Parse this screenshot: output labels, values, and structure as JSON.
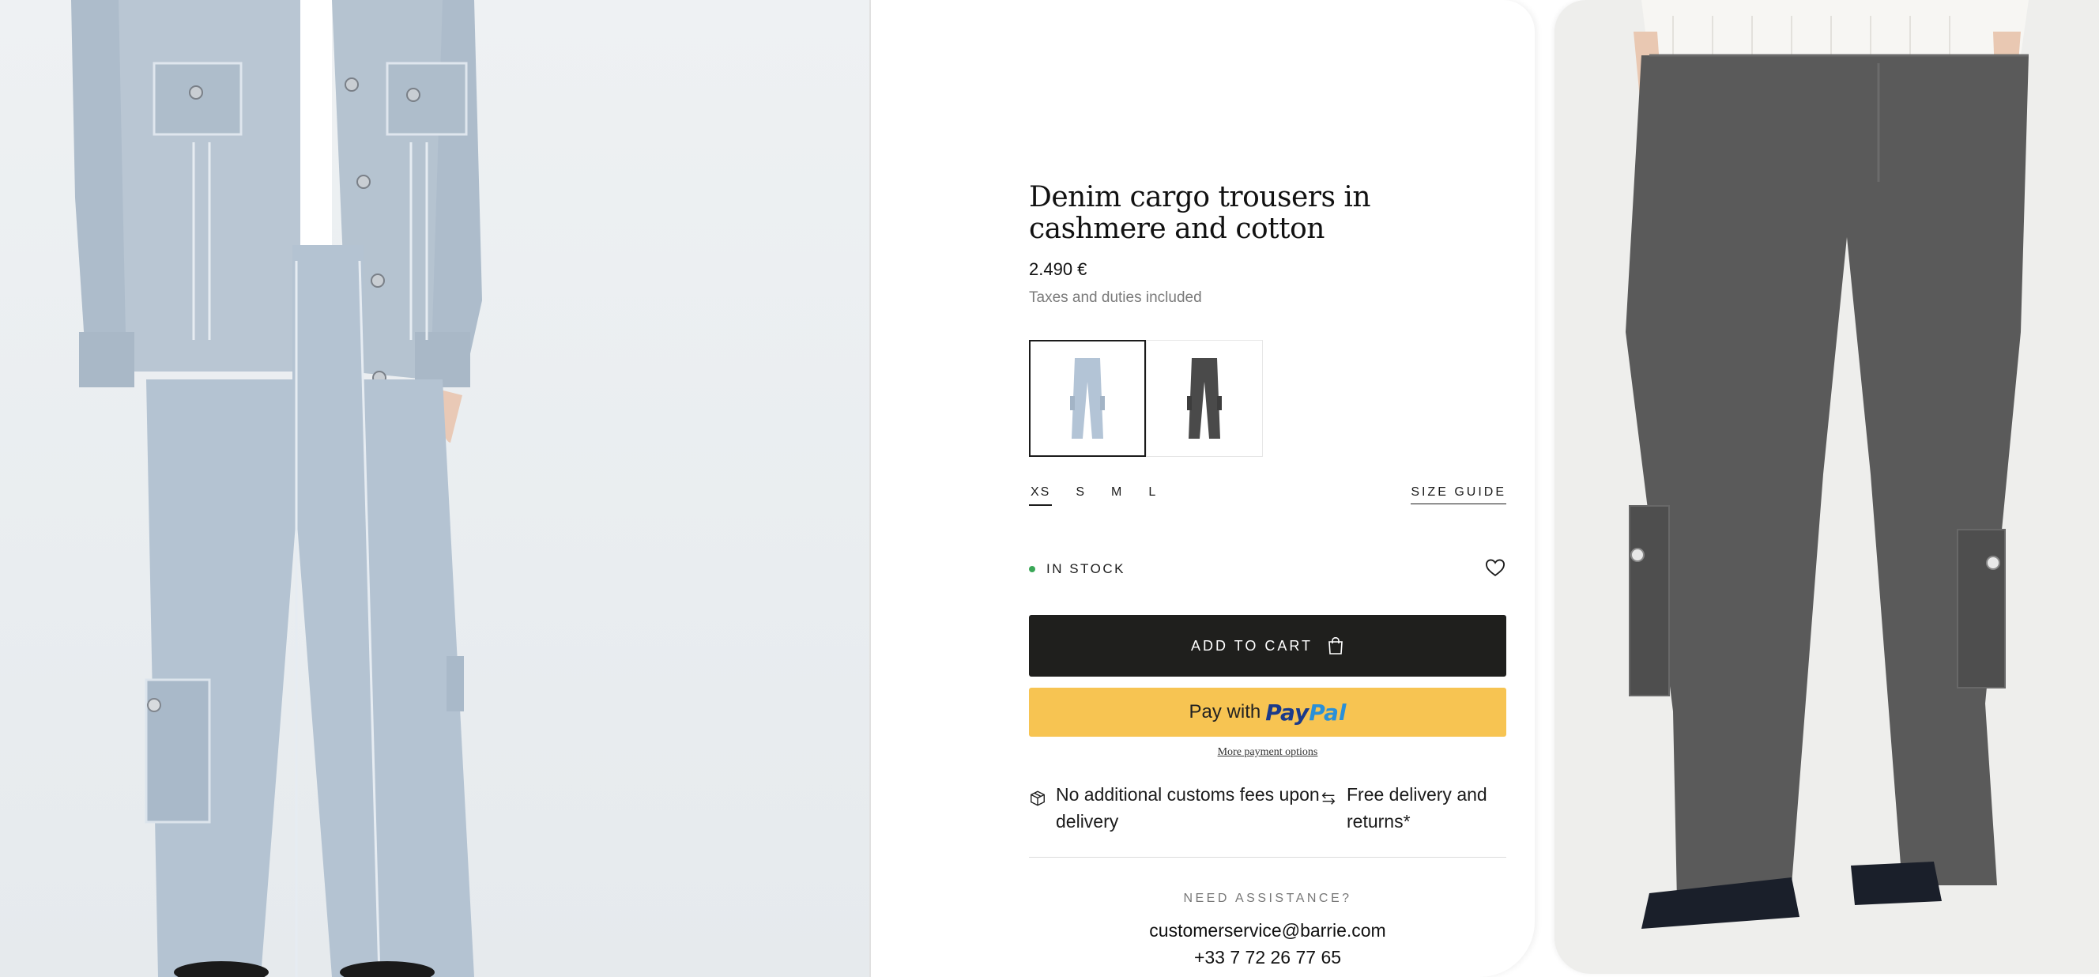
{
  "product": {
    "title": "Denim cargo trousers in cashmere and cotton",
    "price": "2.490 €",
    "tax_note": "Taxes and duties included"
  },
  "swatches": [
    {
      "color_name": "light blue",
      "hex": "#b3c4d6",
      "selected": true
    },
    {
      "color_name": "dark grey",
      "hex": "#4a4a4a",
      "selected": false
    }
  ],
  "sizes": {
    "options": [
      "XS",
      "S",
      "M",
      "L"
    ],
    "selected": "XS",
    "guide_label": "SIZE GUIDE"
  },
  "stock": {
    "label": "IN STOCK",
    "status_color": "#3aa757"
  },
  "actions": {
    "add_to_cart": "ADD TO CART",
    "paypal_prefix": "Pay with",
    "paypal_brand_1": "Pay",
    "paypal_brand_2": "Pal",
    "more_payment": "More payment options"
  },
  "benefits": [
    {
      "icon": "box-icon",
      "text": "No additional customs fees upon delivery"
    },
    {
      "icon": "exchange-arrows-icon",
      "text": "Free delivery and returns*"
    }
  ],
  "assistance": {
    "title": "NEED ASSISTANCE?",
    "email": "customerservice@barrie.com",
    "phone": "+33 7 72 26 77 65"
  },
  "colors": {
    "cart_button": "#1f1f1d",
    "paypal_button": "#f7c452",
    "paypal_dark": "#1a3a8a",
    "paypal_light": "#2a90d8"
  }
}
